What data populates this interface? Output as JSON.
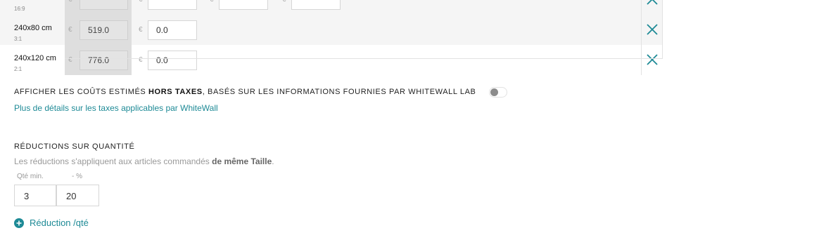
{
  "price_rows": [
    {
      "size": "",
      "ratio": "16:9",
      "currency": "€",
      "buy_price": "",
      "sell_prices": [
        "",
        "",
        ""
      ]
    },
    {
      "size": "240x80 cm",
      "ratio": "3:1",
      "currency": "€",
      "buy_price": "519.0",
      "sell_prices": [
        "0.0"
      ]
    },
    {
      "size": "240x120 cm",
      "ratio": "2:1",
      "currency": "€",
      "buy_price": "776.0",
      "sell_prices": [
        "0.0"
      ]
    }
  ],
  "tax": {
    "text_before": "AFFICHER LES COÛTS ESTIMÉS ",
    "text_bold": "HORS TAXES",
    "text_after": ", BASÉS SUR LES INFORMATIONS FOURNIES PAR WHITEWALL LAB",
    "toggle_on": false,
    "link_text": "Plus de détails sur les taxes applicables par WhiteWall"
  },
  "quantity_discounts": {
    "title": "RÉDUCTIONS SUR QUANTITÉ",
    "desc_before": "Les réductions s'appliquent aux articles commandés ",
    "desc_bold": "de même Taille",
    "desc_after": ".",
    "col_min_qty": "Qté min.",
    "col_percent": "- %",
    "min_qty": "3",
    "percent": "20",
    "add_label": "Réduction /qté"
  },
  "colors": {
    "accent": "#1e8a96",
    "delete": "#1e8a96"
  }
}
